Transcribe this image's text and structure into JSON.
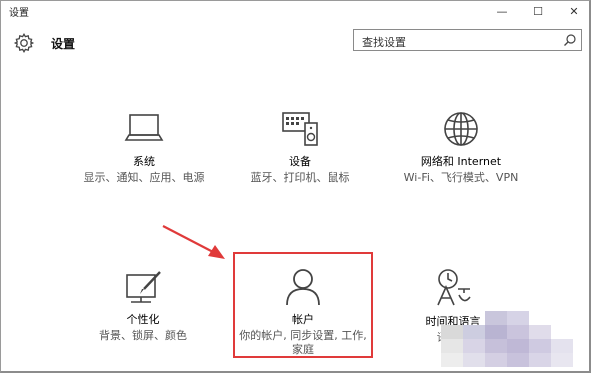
{
  "window": {
    "title": "设置",
    "controls": {
      "minimize": "—",
      "maximize": "☐",
      "close": "✕"
    }
  },
  "header": {
    "title": "设置",
    "search_placeholder": "查找设置"
  },
  "tiles": [
    {
      "label": "系统",
      "desc": "显示、通知、应用、电源"
    },
    {
      "label": "设备",
      "desc": "蓝牙、打印机、鼠标"
    },
    {
      "label": "网络和 Internet",
      "desc": "Wi-Fi、飞行模式、VPN"
    },
    {
      "label": "个性化",
      "desc": "背景、锁屏、颜色"
    },
    {
      "label": "帐户",
      "desc": "你的帐户, 同步设置, 工作, 家庭"
    },
    {
      "label": "时间和语言",
      "desc": "语音..."
    }
  ],
  "annotation": {
    "highlight_color": "#e03a3a"
  }
}
